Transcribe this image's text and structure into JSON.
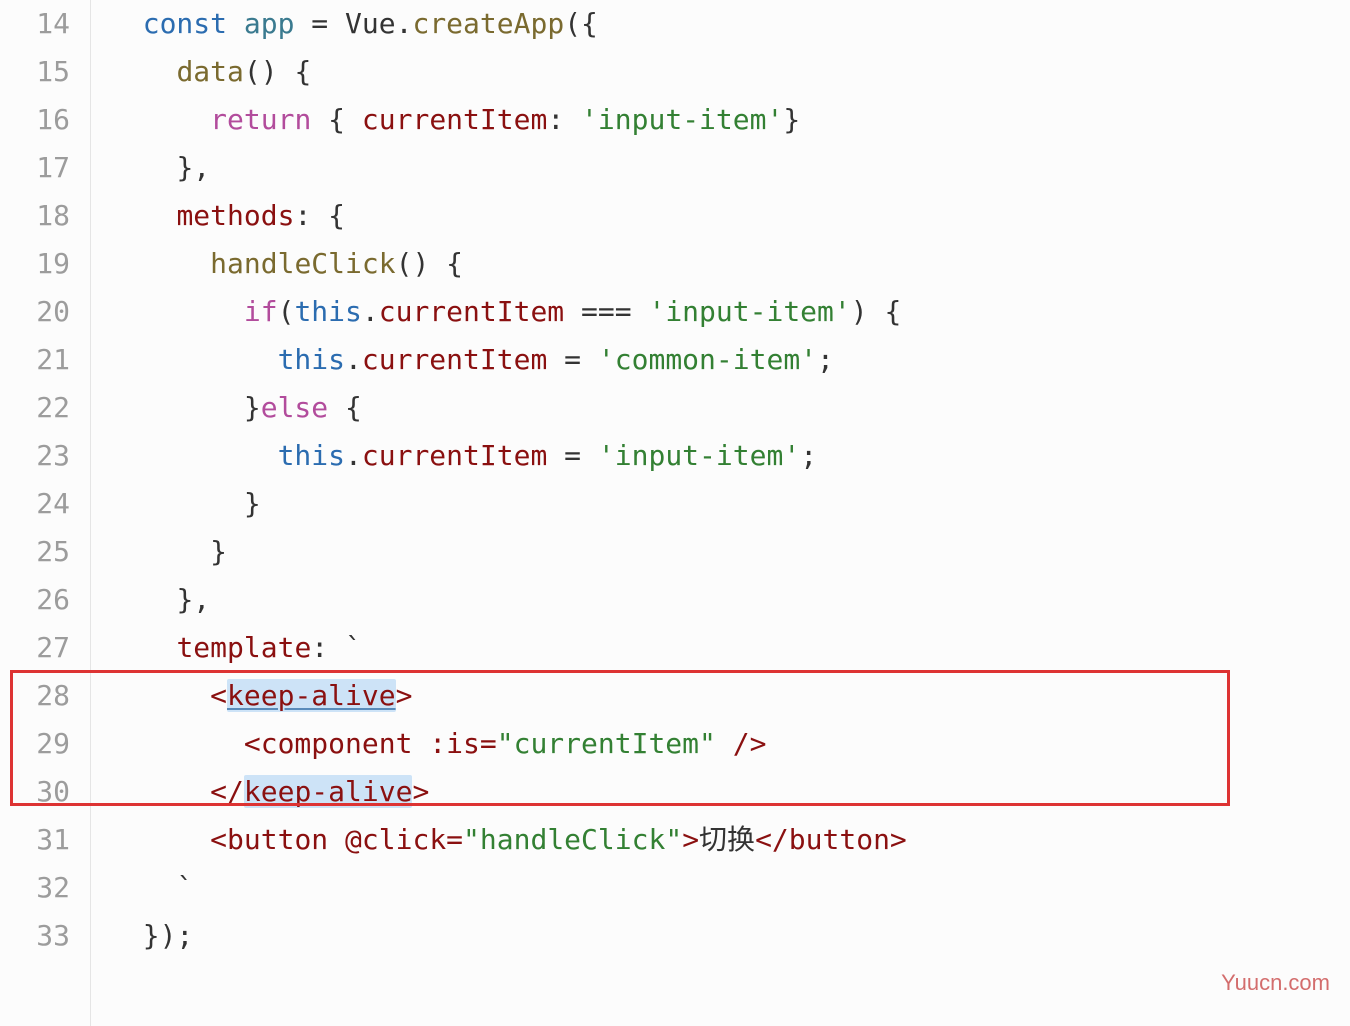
{
  "watermark": "Yuucn.com",
  "gutter": {
    "start": 14,
    "end": 33
  },
  "code": {
    "l14": {
      "kw": "const",
      "app": "app",
      "eq": " = ",
      "vue": "Vue",
      "dot": ".",
      "create": "createApp",
      "open": "({"
    },
    "l15": {
      "prop": "data",
      "rest": "() {"
    },
    "l16": {
      "kw": "return",
      "open": " { ",
      "prop": "currentItem",
      "colon": ": ",
      "str": "'input-item'",
      "close": "}"
    },
    "l17": {
      "txt": "},"
    },
    "l18": {
      "prop": "methods",
      "rest": ": {"
    },
    "l19": {
      "fn": "handleClick",
      "rest": "() {"
    },
    "l20": {
      "kw": "if",
      "open": "(",
      "this": "this",
      "dot": ".",
      "prop": "currentItem",
      "eq": " === ",
      "str": "'input-item'",
      "close": ") {"
    },
    "l21": {
      "this": "this",
      "dot": ".",
      "prop": "currentItem",
      "eq": " = ",
      "str": "'common-item'",
      "semi": ";"
    },
    "l22": {
      "close": "}",
      "kw": "else",
      "open": " {"
    },
    "l23": {
      "this": "this",
      "dot": ".",
      "prop": "currentItem",
      "eq": " = ",
      "str": "'input-item'",
      "semi": ";"
    },
    "l24": {
      "txt": "}"
    },
    "l25": {
      "txt": "}"
    },
    "l26": {
      "txt": "},"
    },
    "l27": {
      "prop": "template",
      "rest": ": `"
    },
    "l28": {
      "open": "<",
      "tag": "keep-alive",
      "close": ">"
    },
    "l29": {
      "open": "<",
      "tag": "component",
      "attr": " :is=",
      "val": "\"currentItem\"",
      "end": " />"
    },
    "l30": {
      "open": "</",
      "tag": "keep-alive",
      "close": ">"
    },
    "l31": {
      "open": "<",
      "tag": "button",
      "attr": " @click=",
      "val": "\"handleClick\"",
      "mid": ">",
      "text": "切换",
      "end": "</button>"
    },
    "l32": {
      "txt": "`"
    },
    "l33": {
      "txt": "});"
    }
  }
}
